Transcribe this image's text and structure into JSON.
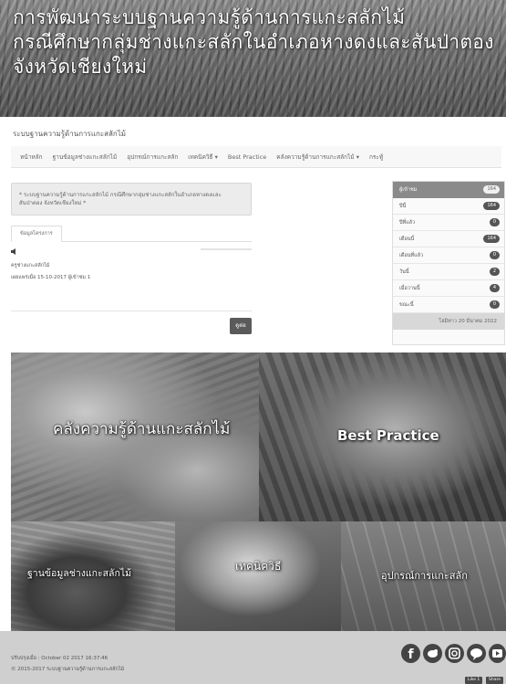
{
  "banner": {
    "title_line1": "การพัฒนาระบบฐานความรู้ด้านการแกะสลักไม้",
    "title_line2": "กรณีศึกษากลุ่มช่างแกะสลักในอำเภอหางดงและสันป่าตอง",
    "title_line3": "จังหวัดเชียงใหม่"
  },
  "site_name": "ระบบฐานความรู้ด้านการแกะสลักไม้",
  "nav": {
    "home": "หน้าหลัก",
    "craftsman_db": "ฐานข้อมูลช่างแกะสลักไม้",
    "tools": "อุปกรณ์การแกะสลัก",
    "techniques": "เทคนิควิธี ▾",
    "best_practice": "Best Practice",
    "knowledge": "คลังความรู้ด้านการแกะสลักไม้ ▾",
    "faq": "กระทู้"
  },
  "notice": "* ระบบฐานความรู้ด้านการแกะสลักไม้ กรณีศึกษากลุ่มช่างแกะสลักในอำเภอหางดงและสันป่าตอง จังหวัดเชียงใหม่ *",
  "tab_label": "ข้อมูลโครงการ",
  "project": {
    "line1": "ครูช่างแกะสลักไม้",
    "line2": "เผยแพร่เมื่อ 15-10-2017 ผู้เข้าชม 1"
  },
  "more_button": "ดูต่อ",
  "stats": {
    "rows": [
      {
        "label": "ผู้เข้าชม",
        "value": "164"
      },
      {
        "label": "ปีนี้",
        "value": "164"
      },
      {
        "label": "ปีที่แล้ว",
        "value": "0"
      },
      {
        "label": "เดือนนี้",
        "value": "164"
      },
      {
        "label": "เดือนที่แล้ว",
        "value": "0"
      },
      {
        "label": "วันนี้",
        "value": "2"
      },
      {
        "label": "เมื่อวานนี้",
        "value": "4"
      },
      {
        "label": "ขณะนี้",
        "value": "0"
      }
    ],
    "footer": "โฮมิทาว 20 มีนาคม 2022"
  },
  "tiles": {
    "knowledge": "คลังความรู้ด้านแกะสลักไม้",
    "best_practice": "Best Practice",
    "craftsman_db": "ฐานข้อมูลช่างแกะสลักไม้",
    "techniques": "เทคนิควิธี",
    "tools": "อุปกรณ์การแกะสลัก"
  },
  "footer": {
    "updated": "ปรับปรุงเมื่อ : October 02 2017 16:37:46",
    "copyright": "© 2015-2017 ระบบฐานความรู้ด้านการแกะสลักไม้",
    "like": "Like 1",
    "share": "Share"
  },
  "social_icons": [
    "facebook-icon",
    "twitter-icon",
    "instagram-icon",
    "line-icon",
    "youtube-icon"
  ]
}
